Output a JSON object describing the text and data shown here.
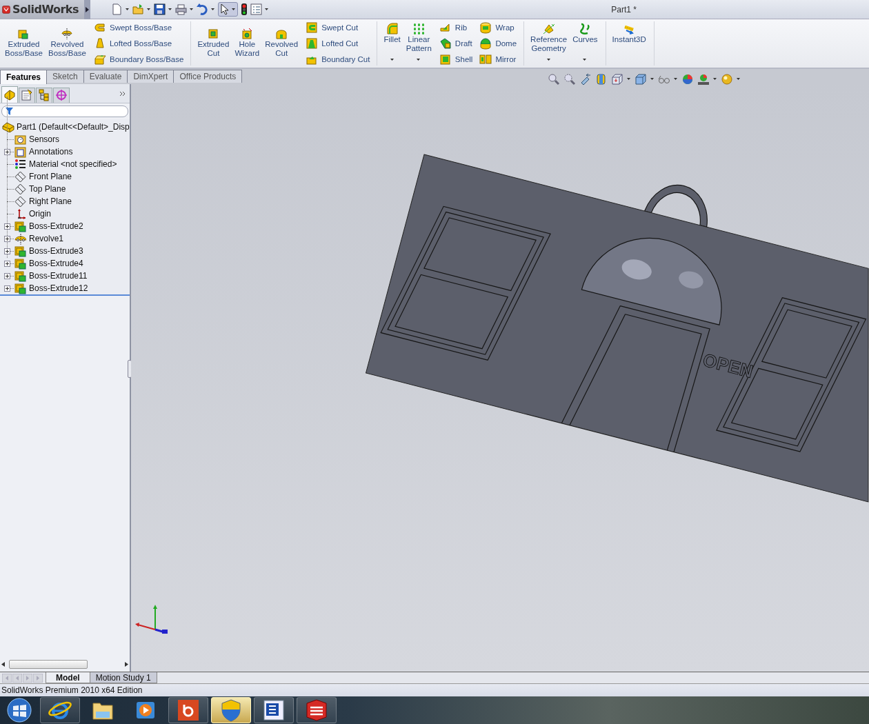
{
  "window": {
    "app_name": "SolidWorks",
    "title": "Part1 *"
  },
  "ribbon": [
    {
      "items": [
        {
          "kind": "large",
          "label": "Extruded\nBoss/Base",
          "dropdown": false
        },
        {
          "kind": "large",
          "label": "Revolved\nBoss/Base",
          "dropdown": false
        },
        {
          "kind": "small",
          "label": "Swept Boss/Base"
        },
        {
          "kind": "small",
          "label": "Lofted Boss/Base"
        },
        {
          "kind": "small",
          "label": "Boundary Boss/Base"
        }
      ]
    },
    {
      "items": [
        {
          "kind": "large",
          "label": "Extruded\nCut",
          "dropdown": false
        },
        {
          "kind": "large",
          "label": "Hole\nWizard",
          "dropdown": false
        },
        {
          "kind": "large",
          "label": "Revolved\nCut",
          "dropdown": false
        },
        {
          "kind": "small",
          "label": "Swept Cut"
        },
        {
          "kind": "small",
          "label": "Lofted Cut"
        },
        {
          "kind": "small",
          "label": "Boundary Cut"
        }
      ]
    },
    {
      "items": [
        {
          "kind": "large",
          "label": "Fillet",
          "dropdown": true
        },
        {
          "kind": "large",
          "label": "Linear\nPattern",
          "dropdown": true
        },
        {
          "kind": "small",
          "label": "Rib"
        },
        {
          "kind": "small",
          "label": "Draft"
        },
        {
          "kind": "small",
          "label": "Shell"
        },
        {
          "kind": "small",
          "label": "Wrap"
        },
        {
          "kind": "small",
          "label": "Dome"
        },
        {
          "kind": "small",
          "label": "Mirror"
        }
      ]
    },
    {
      "items": [
        {
          "kind": "large",
          "label": "Reference\nGeometry",
          "dropdown": true
        },
        {
          "kind": "large",
          "label": "Curves",
          "dropdown": true
        }
      ]
    },
    {
      "items": [
        {
          "kind": "large",
          "label": "Instant3D",
          "dropdown": false
        }
      ]
    }
  ],
  "command_tabs": [
    {
      "label": "Features",
      "selected": true
    },
    {
      "label": "Sketch",
      "selected": false
    },
    {
      "label": "Evaluate",
      "selected": false
    },
    {
      "label": "DimXpert",
      "selected": false
    },
    {
      "label": "Office Products",
      "selected": false
    }
  ],
  "manager_tabs": [
    {
      "selected": true
    },
    {
      "selected": false
    },
    {
      "selected": false
    },
    {
      "selected": false
    }
  ],
  "feature_tree": {
    "label": "Part1  (Default<<Default>_Disp",
    "children": [
      {
        "kind": "sensors",
        "label": "Sensors",
        "has_children": false
      },
      {
        "kind": "annotations",
        "label": "Annotations",
        "has_children": true
      },
      {
        "kind": "material",
        "label": "Material <not specified>",
        "has_children": false
      },
      {
        "kind": "plane",
        "label": "Front Plane",
        "has_children": false
      },
      {
        "kind": "plane",
        "label": "Top Plane",
        "has_children": false
      },
      {
        "kind": "plane",
        "label": "Right Plane",
        "has_children": false
      },
      {
        "kind": "origin",
        "label": "Origin",
        "has_children": false
      },
      {
        "kind": "extrude",
        "label": "Boss-Extrude2",
        "has_children": true
      },
      {
        "kind": "revolve",
        "label": "Revolve1",
        "has_children": true
      },
      {
        "kind": "extrude",
        "label": "Boss-Extrude3",
        "has_children": true
      },
      {
        "kind": "extrude",
        "label": "Boss-Extrude4",
        "has_children": true
      },
      {
        "kind": "extrude",
        "label": "Boss-Extrude11",
        "has_children": true
      },
      {
        "kind": "extrude",
        "label": "Boss-Extrude12",
        "has_children": true
      }
    ]
  },
  "viewport": {
    "model_text": "OPEN"
  },
  "bottom_tabs": [
    {
      "label": "Model",
      "selected": true
    },
    {
      "label": "Motion Study 1",
      "selected": false
    }
  ],
  "status_bar": "SolidWorks Premium 2010 x64 Edition",
  "taskbar": [
    {
      "kind": "start",
      "selected": false
    },
    {
      "kind": "browser",
      "selected": false
    },
    {
      "kind": "folder",
      "selected": false
    },
    {
      "kind": "media",
      "selected": false
    },
    {
      "kind": "letter-b",
      "selected": false
    },
    {
      "kind": "shield",
      "selected": true
    },
    {
      "kind": "word",
      "selected": false
    },
    {
      "kind": "cad",
      "selected": false
    }
  ]
}
